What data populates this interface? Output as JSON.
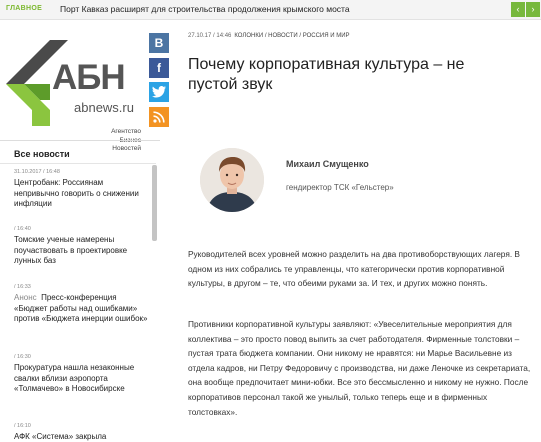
{
  "ticker": {
    "label": "ГЛАВНОЕ",
    "text": "Порт Кавказ расширят для строительства продолжения крымского моста",
    "prev_icon": "chevron-left-icon",
    "next_icon": "chevron-right-icon",
    "prev_glyph": "‹",
    "next_glyph": "›"
  },
  "logo": {
    "abn": "АБН",
    "domain": "abnews.ru",
    "tagline": [
      "Агентство",
      "Бизнес",
      "Новостей"
    ]
  },
  "social": [
    {
      "name": "vk-icon",
      "glyph": "B",
      "color": "#4c75a3"
    },
    {
      "name": "facebook-icon",
      "glyph": "f",
      "color": "#3b5998"
    },
    {
      "name": "twitter-icon",
      "glyph": "t",
      "color": "#2ba3e5"
    },
    {
      "name": "rss-icon",
      "glyph": "◝",
      "color": "#f39322"
    }
  ],
  "news": {
    "title": "Все новости",
    "items": [
      {
        "time": "31.10.2017 / 16:48",
        "prefix": "",
        "text": "Центробанк: Россиянам непривычно говорить о снижении инфляции"
      },
      {
        "time": "/ 16:40",
        "prefix": "",
        "text": "Томские ученые намерены поучаствовать в проектировке лунных баз"
      },
      {
        "time": "/ 16:33",
        "prefix": "Анонс",
        "text": "Пресс-конференция «Бюджет работы над ошибками» против «Бюджета инерции ошибок»"
      },
      {
        "time": "/ 16:30",
        "prefix": "",
        "text": "Прокуратура нашла незаконные свалки вблизи аэропорта «Толмачево» в Новосибирске"
      },
      {
        "time": "/ 16:10",
        "prefix": "",
        "text": "АФК «Система» закрыла"
      }
    ]
  },
  "article": {
    "date": "27.10.17 / 14:46",
    "breadcrumbs": "КОЛОНКИ / НОВОСТИ / РОССИЯ И МИР",
    "title": "Почему корпоративная культура – не пустой звук",
    "author_name": "Михаил Смущенко",
    "author_role": "гендиректор ТСК «Гельстер»",
    "paragraphs": [
      "Руководителей всех уровней можно разделить на два противоборствующих лагеря. В одном из них собрались те управленцы, что категорически против корпоративной культуры, в другом – те, что обеими руками за. И тех, и других можно понять.",
      "Противники корпоративной культуры заявляют: «Увеселительные мероприятия для коллектива – это просто повод выпить за счет работодателя. Фирменные толстовки – пустая трата бюджета компании. Они никому не нравятся: ни Марье Васильевне из отдела кадров, ни Петру Федоровичу с производства, ни даже Леночке из секретариата, она вообще предпочитает мини-юбки. Все это бессмысленно и никому не нужно. После корпоративов персонал такой же унылый, только теперь еще и в фирменных толстовках»."
    ]
  },
  "colors": {
    "accent": "#7cb82f",
    "ticker_button": "#77b83c",
    "logo_green": "#8bc53f",
    "logo_gray": "#555555"
  }
}
